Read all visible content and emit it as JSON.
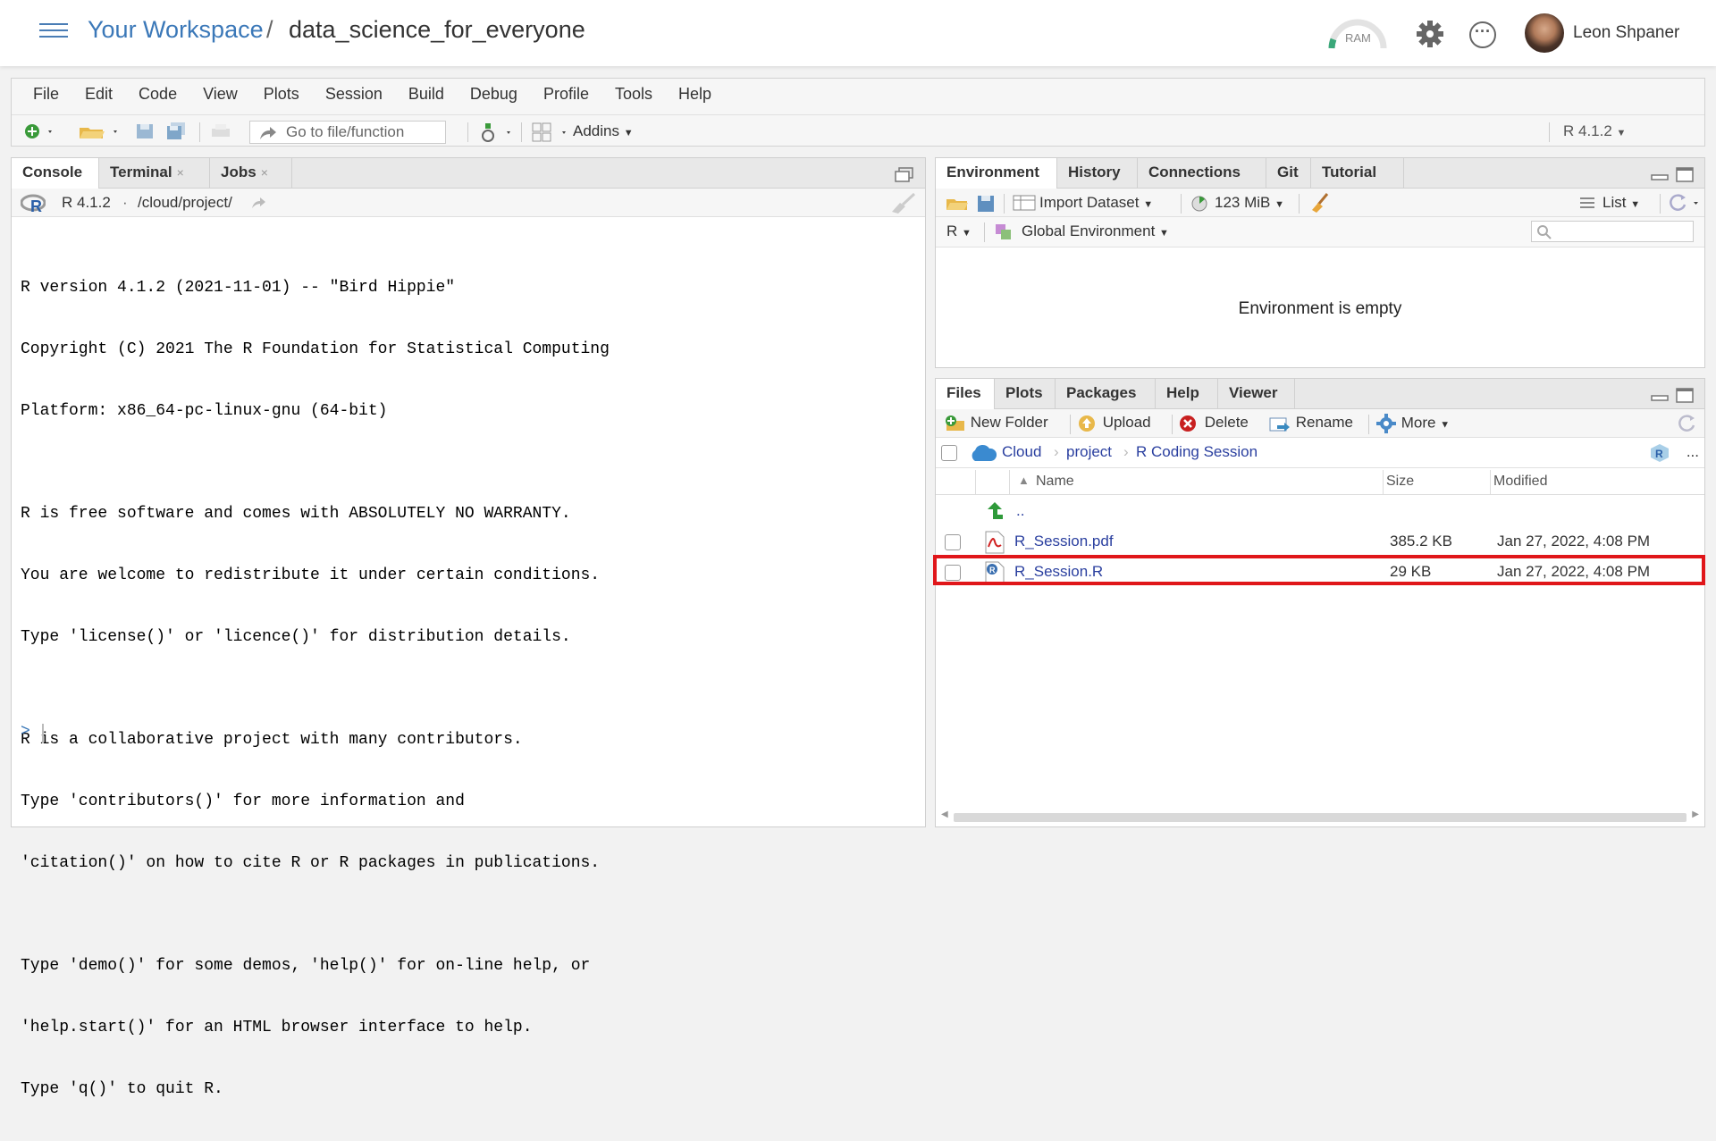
{
  "header": {
    "workspace_link": "Your Workspace",
    "separator": "/",
    "project_name": "data_science_for_everyone",
    "ram_label": "RAM",
    "user_name": "Leon Shpaner"
  },
  "menu": [
    "File",
    "Edit",
    "Code",
    "View",
    "Plots",
    "Session",
    "Build",
    "Debug",
    "Profile",
    "Tools",
    "Help"
  ],
  "toolbar": {
    "goto_placeholder": "Go to file/function",
    "addins_label": "Addins",
    "r_version": "R 4.1.2"
  },
  "console_pane": {
    "tabs": [
      {
        "label": "Console"
      },
      {
        "label": "Terminal",
        "close": "×"
      },
      {
        "label": "Jobs",
        "close": "×"
      }
    ],
    "path_version": "R 4.1.2",
    "path_sep": "·",
    "path": "/cloud/project/",
    "lines": [
      "R version 4.1.2 (2021-11-01) -- \"Bird Hippie\"",
      "Copyright (C) 2021 The R Foundation for Statistical Computing",
      "Platform: x86_64-pc-linux-gnu (64-bit)",
      "",
      "R is free software and comes with ABSOLUTELY NO WARRANTY.",
      "You are welcome to redistribute it under certain conditions.",
      "Type 'license()' or 'licence()' for distribution details.",
      "",
      "R is a collaborative project with many contributors.",
      "Type 'contributors()' for more information and",
      "'citation()' on how to cite R or R packages in publications.",
      "",
      "Type 'demo()' for some demos, 'help()' for on-line help, or",
      "'help.start()' for an HTML browser interface to help.",
      "Type 'q()' to quit R."
    ],
    "prompt": ">"
  },
  "env_pane": {
    "tabs": [
      "Environment",
      "History",
      "Connections",
      "Git",
      "Tutorial"
    ],
    "import_dataset": "Import Dataset",
    "memory": "123 MiB",
    "list_label": "List",
    "lang": "R",
    "global_env": "Global Environment",
    "empty_msg": "Environment is empty"
  },
  "files_pane": {
    "tabs": [
      "Files",
      "Plots",
      "Packages",
      "Help",
      "Viewer"
    ],
    "new_folder": "New Folder",
    "upload": "Upload",
    "delete": "Delete",
    "rename": "Rename",
    "more": "More",
    "breadcrumb": [
      "Cloud",
      "project",
      "R Coding Session"
    ],
    "ellipsis": "...",
    "columns": {
      "name": "Name",
      "size": "Size",
      "modified": "Modified"
    },
    "parent_dir": "..",
    "files": [
      {
        "name": "R_Session.pdf",
        "size": "385.2 KB",
        "modified": "Jan 27, 2022, 4:08 PM",
        "icon": "pdf-file-icon"
      },
      {
        "name": "R_Session.R",
        "size": "29 KB",
        "modified": "Jan 27, 2022, 4:08 PM",
        "icon": "r-script-file-icon"
      }
    ]
  },
  "colors": {
    "accent": "#3b78b8",
    "highlight": "#e0161a",
    "link": "#2a3f9f"
  }
}
